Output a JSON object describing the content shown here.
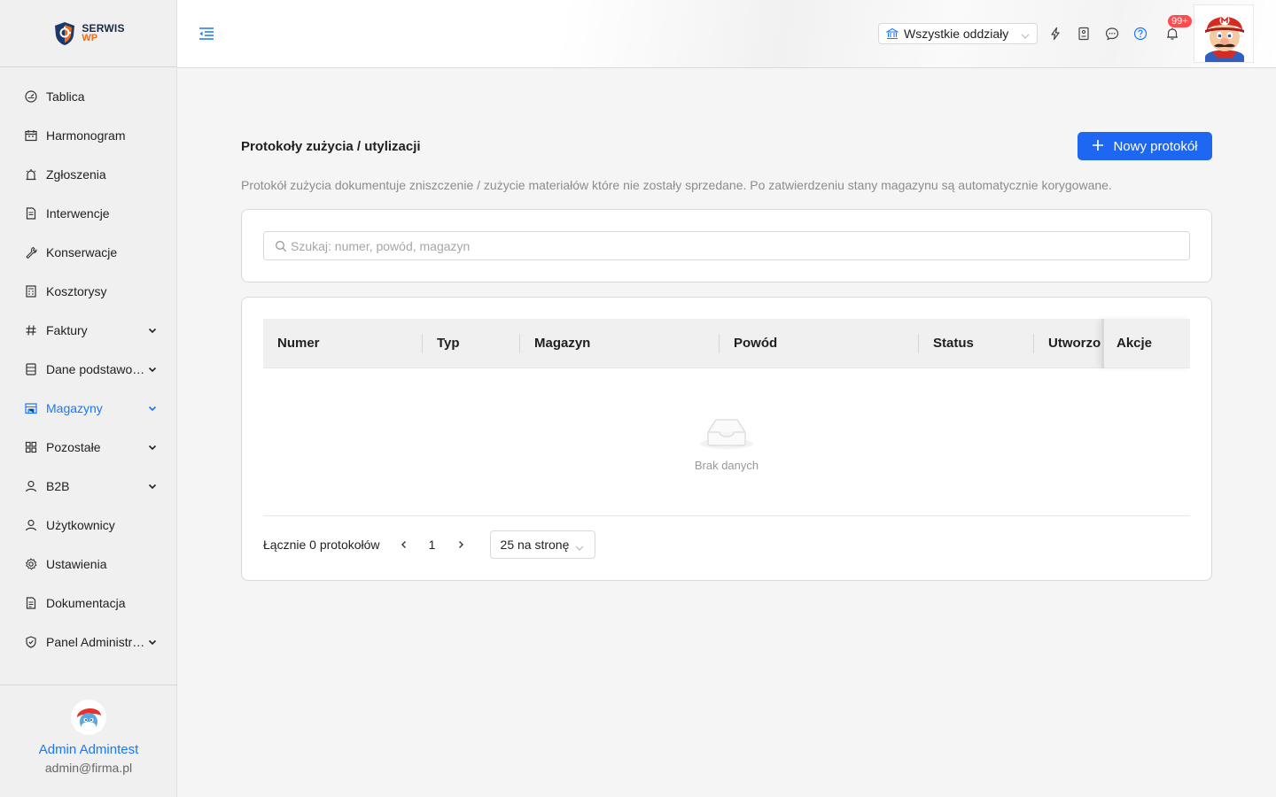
{
  "brand": {
    "line1": "SERWIS",
    "line2": "WP"
  },
  "sidebar": {
    "items": [
      {
        "label": "Tablica",
        "icon": "dashboard-icon",
        "expandable": false,
        "active": false
      },
      {
        "label": "Harmonogram",
        "icon": "calendar-icon",
        "expandable": false,
        "active": false
      },
      {
        "label": "Zgłoszenia",
        "icon": "alarm-icon",
        "expandable": false,
        "active": false
      },
      {
        "label": "Interwencje",
        "icon": "file-icon",
        "expandable": false,
        "active": false
      },
      {
        "label": "Konserwacje",
        "icon": "wrench-icon",
        "expandable": false,
        "active": false
      },
      {
        "label": "Kosztorysy",
        "icon": "calculator-icon",
        "expandable": false,
        "active": false
      },
      {
        "label": "Faktury",
        "icon": "hash-icon",
        "expandable": true,
        "active": false
      },
      {
        "label": "Dane podstawowe",
        "icon": "database-icon",
        "expandable": true,
        "active": false
      },
      {
        "label": "Magazyny",
        "icon": "warehouse-icon",
        "expandable": true,
        "active": true
      },
      {
        "label": "Pozostałe",
        "icon": "grid-icon",
        "expandable": true,
        "active": false
      },
      {
        "label": "B2B",
        "icon": "user-icon",
        "expandable": true,
        "active": false
      },
      {
        "label": "Użytkownicy",
        "icon": "user-icon",
        "expandable": false,
        "active": false
      },
      {
        "label": "Ustawienia",
        "icon": "settings-icon",
        "expandable": false,
        "active": false
      },
      {
        "label": "Dokumentacja",
        "icon": "document-icon",
        "expandable": false,
        "active": false
      },
      {
        "label": "Panel Administracyjny",
        "icon": "shield-icon",
        "expandable": true,
        "active": false
      }
    ],
    "user": {
      "name": "Admin Admintest",
      "email": "admin@firma.pl"
    }
  },
  "header": {
    "branch_select": "Wszystkie oddziały",
    "notifications_badge": "99+"
  },
  "page": {
    "title": "Protokoły zużycia / utylizacji",
    "new_button": "Nowy protokół",
    "description": "Protokół zużycia dokumentuje zniszczenie / zużycie materiałów które nie zostały sprzedane. Po zatwierdzeniu stany magazynu są automatycznie korygowane.",
    "search_placeholder": "Szukaj: numer, powód, magazyn",
    "columns": [
      "Numer",
      "Typ",
      "Magazyn",
      "Powód",
      "Status",
      "Utworzono",
      "Akcje"
    ],
    "empty_text": "Brak danych",
    "pagination": {
      "total": "Łącznie 0 protokołów",
      "current_page": "1",
      "page_size": "25 na stronę"
    }
  },
  "colors": {
    "accent": "#1677ff",
    "button": "#1d67f3",
    "badge": "#ff4d4f"
  }
}
